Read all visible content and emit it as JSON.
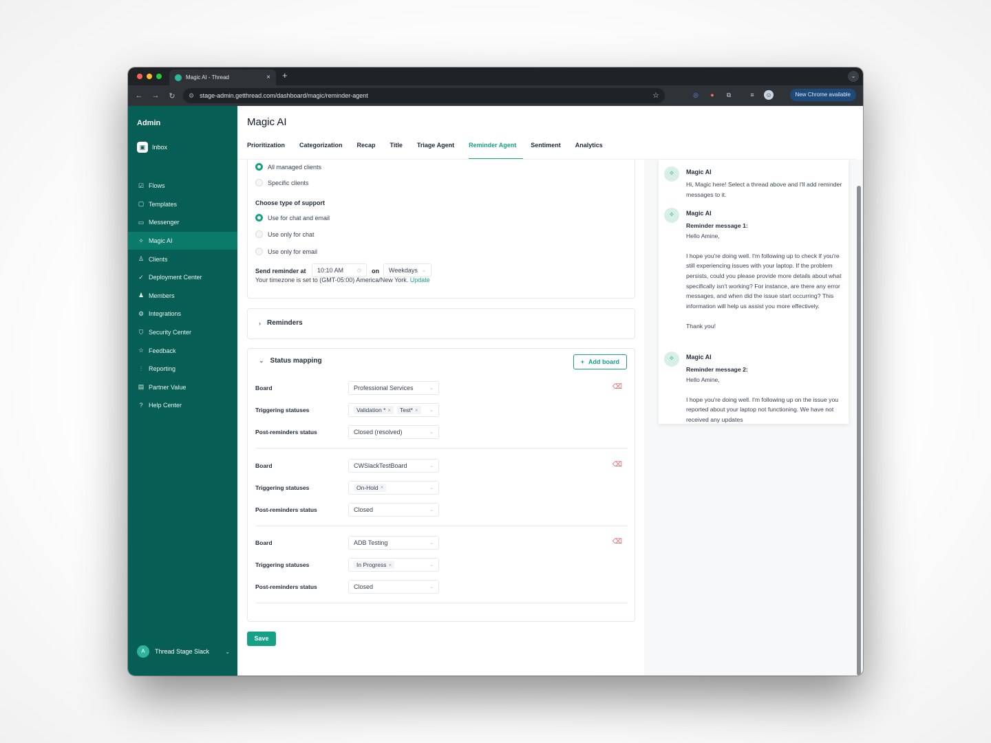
{
  "browser": {
    "tab_title": "Magic AI - Thread",
    "new_tab": "+",
    "url": "stage-admin.getthread.com/dashboard/magic/reminder-agent",
    "new_chrome": "New Chrome available"
  },
  "sidebar": {
    "title": "Admin",
    "inbox": "Inbox",
    "items": [
      {
        "label": "Flows",
        "icon": "flows-icon",
        "glyph": "☑"
      },
      {
        "label": "Templates",
        "icon": "templates-icon",
        "glyph": "▢"
      },
      {
        "label": "Messenger",
        "icon": "messenger-icon",
        "glyph": "▭"
      },
      {
        "label": "Magic AI",
        "icon": "sparkle-icon",
        "glyph": "✧"
      },
      {
        "label": "Clients",
        "icon": "user-icon",
        "glyph": "♙"
      },
      {
        "label": "Deployment Center",
        "icon": "check-circle-icon",
        "glyph": "✓"
      },
      {
        "label": "Members",
        "icon": "members-icon",
        "glyph": "♟"
      },
      {
        "label": "Integrations",
        "icon": "gear-icon",
        "glyph": "⚙"
      },
      {
        "label": "Security Center",
        "icon": "shield-icon",
        "glyph": "⛉"
      },
      {
        "label": "Feedback",
        "icon": "star-icon",
        "glyph": "☆"
      },
      {
        "label": "Reporting",
        "icon": "bar-chart-icon",
        "glyph": "⫶"
      },
      {
        "label": "Partner Value",
        "icon": "wallet-icon",
        "glyph": "▤"
      },
      {
        "label": "Help Center",
        "icon": "help-icon",
        "glyph": "?"
      }
    ],
    "active_index": 3,
    "footer": {
      "avatar": "A",
      "workspace": "Thread Stage Slack"
    }
  },
  "page": {
    "title": "Magic AI",
    "tabs": [
      "Prioritization",
      "Categorization",
      "Recap",
      "Title",
      "Triage Agent",
      "Reminder Agent",
      "Sentiment",
      "Analytics"
    ],
    "active_tab": "Reminder Agent"
  },
  "settings": {
    "clients_options": [
      "All managed clients",
      "Specific clients"
    ],
    "support_label": "Choose type of support",
    "support_options": [
      "Use for chat and email",
      "Use only for chat",
      "Use only for email"
    ],
    "send_label": "Send reminder at",
    "send_time": "10:10 AM",
    "on_label": "on",
    "days": "Weekdays",
    "timezone_text": "Your timezone is set to (GMT-05:00) America/New York.",
    "timezone_link": "Update"
  },
  "reminders": {
    "title": "Reminders"
  },
  "status_mapping": {
    "title": "Status mapping",
    "add_board": "Add board",
    "row_labels": {
      "board": "Board",
      "triggering": "Triggering statuses",
      "post": "Post-reminders status"
    },
    "boards": [
      {
        "board": "Professional Services",
        "triggering": [
          "Validation *",
          "Test*"
        ],
        "post": "Closed (resolved)"
      },
      {
        "board": "CWSlackTestBoard",
        "triggering": [
          "On-Hold"
        ],
        "post": "Closed"
      },
      {
        "board": "ADB Testing",
        "triggering": [
          "In Progress"
        ],
        "post": "Closed"
      }
    ]
  },
  "save_label": "Save",
  "chat": {
    "messages": [
      {
        "name": "Magic AI",
        "heading": "",
        "body": "Hi, Magic here! Select a thread above and I'll add reminder messages to it."
      },
      {
        "name": "Magic AI",
        "heading": "Reminder message 1:",
        "body": "Hello Amine,\n\nI hope you're doing well. I'm following up to check if you're still experiencing issues with your laptop. If the problem persists, could you please provide more details about what specifically isn't working? For instance, are there any error messages, and when did the issue start occurring? This information will help us assist you more effectively.\n\nThank you!"
      },
      {
        "name": "Magic AI",
        "heading": "Reminder message 2:",
        "body": "Hello Amine,\n\nI hope you're doing well. I'm following up on the issue you reported about your laptop not functioning. We have not received any updates"
      }
    ]
  },
  "colors": {
    "sidebar": "#075e54",
    "accent": "#16a085",
    "danger": "#e05a5a"
  }
}
